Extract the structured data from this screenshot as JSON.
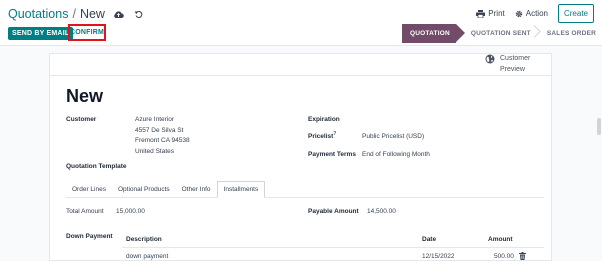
{
  "header": {
    "breadcrumb_parent": "Quotations",
    "breadcrumb_separator": "/",
    "breadcrumb_current": "New",
    "print_label": "Print",
    "action_label": "Action",
    "create_label": "Create"
  },
  "controls": {
    "send_by_email_label": "SEND BY EMAIL",
    "confirm_label": "CONFIRM"
  },
  "status_bar": {
    "stages": [
      "QUOTATION",
      "QUOTATION SENT",
      "SALES ORDER"
    ],
    "active_stage": "QUOTATION"
  },
  "preview": {
    "label_line1": "Customer",
    "label_line2": "Preview"
  },
  "form": {
    "title": "New",
    "customer": {
      "label": "Customer",
      "name": "Azure Interior",
      "street": "4557 De Silva St",
      "city": "Fremont CA 94538",
      "country": "United States"
    },
    "expiration": {
      "label": "Expiration",
      "value": ""
    },
    "pricelist": {
      "label": "Pricelist",
      "help": "?",
      "value": "Public Pricelist (USD)"
    },
    "payment_terms": {
      "label": "Payment Terms",
      "value": "End of Following Month"
    },
    "quotation_template": {
      "label": "Quotation Template",
      "value": ""
    }
  },
  "tabs": [
    {
      "label": "Order Lines"
    },
    {
      "label": "Optional Products"
    },
    {
      "label": "Other Info"
    },
    {
      "label": "Installments"
    }
  ],
  "active_tab": "Installments",
  "installments": {
    "total_amount_label": "Total Amount",
    "total_amount_value": "15,000.00",
    "payable_amount_label": "Payable Amount",
    "payable_amount_value": "14,500.00",
    "down_payment_label": "Down Payment",
    "columns": [
      "Description",
      "Date",
      "Amount"
    ],
    "rows": [
      {
        "description": "down payment",
        "date": "12/15/2022",
        "amount": "500.00"
      }
    ]
  },
  "colors": {
    "primary": "#017e84",
    "status_active": "#714b67",
    "highlight_box": "#e0151c"
  },
  "icons": {
    "cloud_save": "cloud-upload-icon",
    "discard": "undo-icon",
    "print": "print-icon",
    "action": "gear-icon",
    "preview": "globe-icon",
    "delete": "trash-icon"
  }
}
